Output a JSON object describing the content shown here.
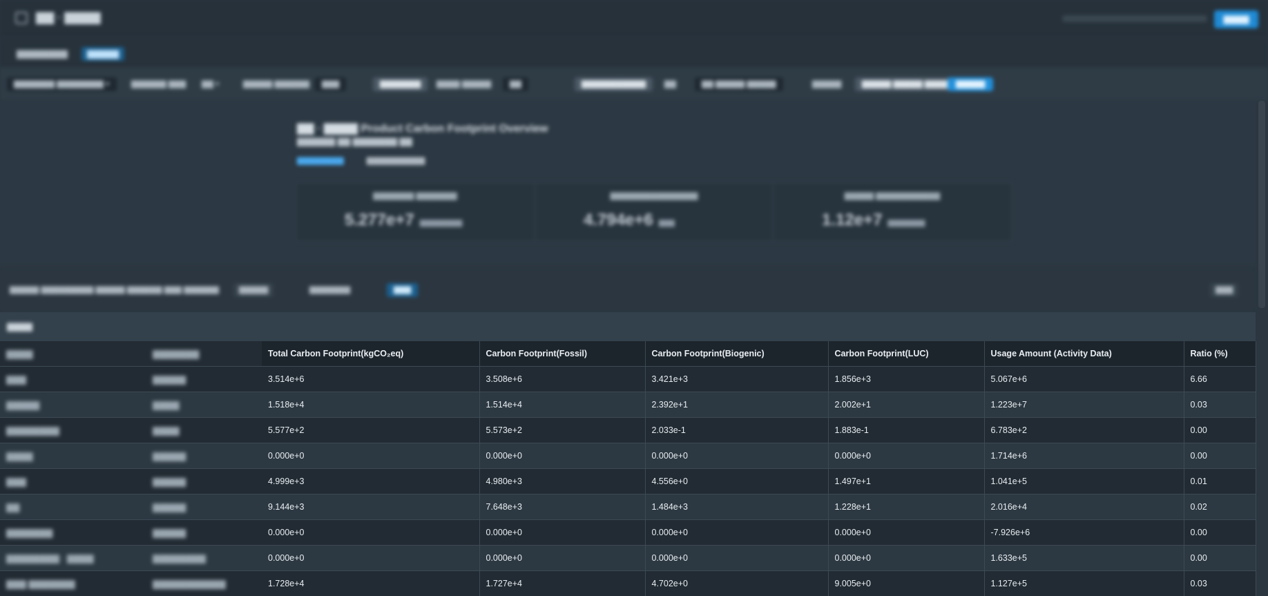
{
  "app": {
    "title": "▇▇ · ▇▇▇▇",
    "top_action": "▇▇▇▇"
  },
  "tabs": [
    "▇▇▇▇▇▇▇▇",
    "▇▇▇▇▇"
  ],
  "toolbar": {
    "items": [
      "▇▇▇▇▇▇▇ ▇▇▇▇▇▇▇▇ ▾",
      "▇▇▇▇▇▇ ▇▇▇",
      "▇▇ ▾",
      "▇▇▇▇▇ ▇▇▇▇▇▇",
      "▇▇▇",
      "▇▇▇▇▇▇▇",
      "▇▇▇▇ ▇▇▇▇▇",
      "▇▇",
      "▇▇▇▇▇▇▇▇▇▇▇",
      "▇▇",
      "▇▇ ▇▇▇▇▇ ▇▇▇▇▇",
      "▇▇▇▇▇",
      "▇▇▇▇▇ ▇▇▇▇▇ ▇▇▇▇",
      "▇▇▇▇▇"
    ]
  },
  "summary": {
    "title": "▇▇ · ▇▇▇▇ Product Carbon Footprint Overview",
    "subtitle": "▇▇▇▇▇▇ ▇▇ ▇▇▇▇▇▇▇ ▇▇",
    "radio_a": "▇▇▇▇▇▇▇▇",
    "radio_b": "▇▇▇▇▇▇▇▇▇▇",
    "cards": [
      {
        "label": "▇▇▇▇▇▇▇ ▇▇▇▇▇▇▇",
        "value": "5.277e+7",
        "unit": "▇▇▇▇▇▇▇▇"
      },
      {
        "label": "▇▇▇▇▇▇▇▇▇▇▇▇▇▇▇",
        "value": "4.794e+6",
        "unit": "▇▇▇"
      },
      {
        "label": "▇▇▇▇▇ ▇▇▇▇▇▇▇▇▇▇▇",
        "value": "1.12e+7",
        "unit": "▇▇▇▇▇▇▇"
      }
    ]
  },
  "actions": {
    "filter": "▇▇▇▇▇ ▇▇▇▇▇▇▇▇▇ ▇▇▇▇▇ ▇▇▇▇▇▇ ▇▇▇ ▇▇▇▇▇▇",
    "btn1": "▇▇▇▇▇",
    "btn2": "▇▇▇▇▇▇▇",
    "btn3": "▇▇▇",
    "right": "▇▇▇"
  },
  "table": {
    "section_label": "▇▇▇▇",
    "headers": [
      "Total Carbon Footprint(kgCO₂eq)",
      "Carbon Footprint(Fossil)",
      "Carbon Footprint(Biogenic)",
      "Carbon Footprint(LUC)",
      "Usage Amount (Activity Data)",
      "Ratio (%)"
    ],
    "left_headers": [
      "▇▇▇▇",
      "▇▇▇▇▇▇▇"
    ],
    "rows": [
      {
        "name": "▇▇▇",
        "cat": "▇▇▇▇▇",
        "v": [
          "3.514e+6",
          "3.508e+6",
          "3.421e+3",
          "1.856e+3",
          "5.067e+6",
          "6.66"
        ]
      },
      {
        "name": "▇▇▇▇▇",
        "cat": "▇▇▇▇",
        "v": [
          "1.518e+4",
          "1.514e+4",
          "2.392e+1",
          "2.002e+1",
          "1.223e+7",
          "0.03"
        ]
      },
      {
        "name": "▇▇▇▇▇▇▇▇",
        "cat": "▇▇▇▇",
        "v": [
          "5.577e+2",
          "5.573e+2",
          "2.033e-1",
          "1.883e-1",
          "6.783e+2",
          "0.00"
        ]
      },
      {
        "name": "▇▇▇▇",
        "cat": "▇▇▇▇▇",
        "v": [
          "0.000e+0",
          "0.000e+0",
          "0.000e+0",
          "0.000e+0",
          "1.714e+6",
          "0.00"
        ]
      },
      {
        "name": "▇▇▇",
        "cat": "▇▇▇▇▇",
        "v": [
          "4.999e+3",
          "4.980e+3",
          "4.556e+0",
          "1.497e+1",
          "1.041e+5",
          "0.01"
        ]
      },
      {
        "name": "▇▇",
        "cat": "▇▇▇▇▇",
        "v": [
          "9.144e+3",
          "7.648e+3",
          "1.484e+3",
          "1.228e+1",
          "2.016e+4",
          "0.02"
        ]
      },
      {
        "name": "▇▇▇▇▇▇▇",
        "cat": "▇▇▇▇▇",
        "v": [
          "0.000e+0",
          "0.000e+0",
          "0.000e+0",
          "0.000e+0",
          "-7.926e+6",
          "0.00"
        ]
      },
      {
        "name": "▇▇▇▇▇▇▇▇ · ▇▇▇▇",
        "cat": "▇▇▇▇▇▇▇▇",
        "v": [
          "0.000e+0",
          "0.000e+0",
          "0.000e+0",
          "0.000e+0",
          "1.633e+5",
          "0.00"
        ]
      },
      {
        "name": "▇▇▇ ▇▇▇▇▇▇▇",
        "cat": "▇▇▇▇▇▇▇▇▇▇▇",
        "v": [
          "1.728e+4",
          "1.727e+4",
          "4.702e+0",
          "9.005e+0",
          "1.127e+5",
          "0.03"
        ]
      }
    ]
  }
}
